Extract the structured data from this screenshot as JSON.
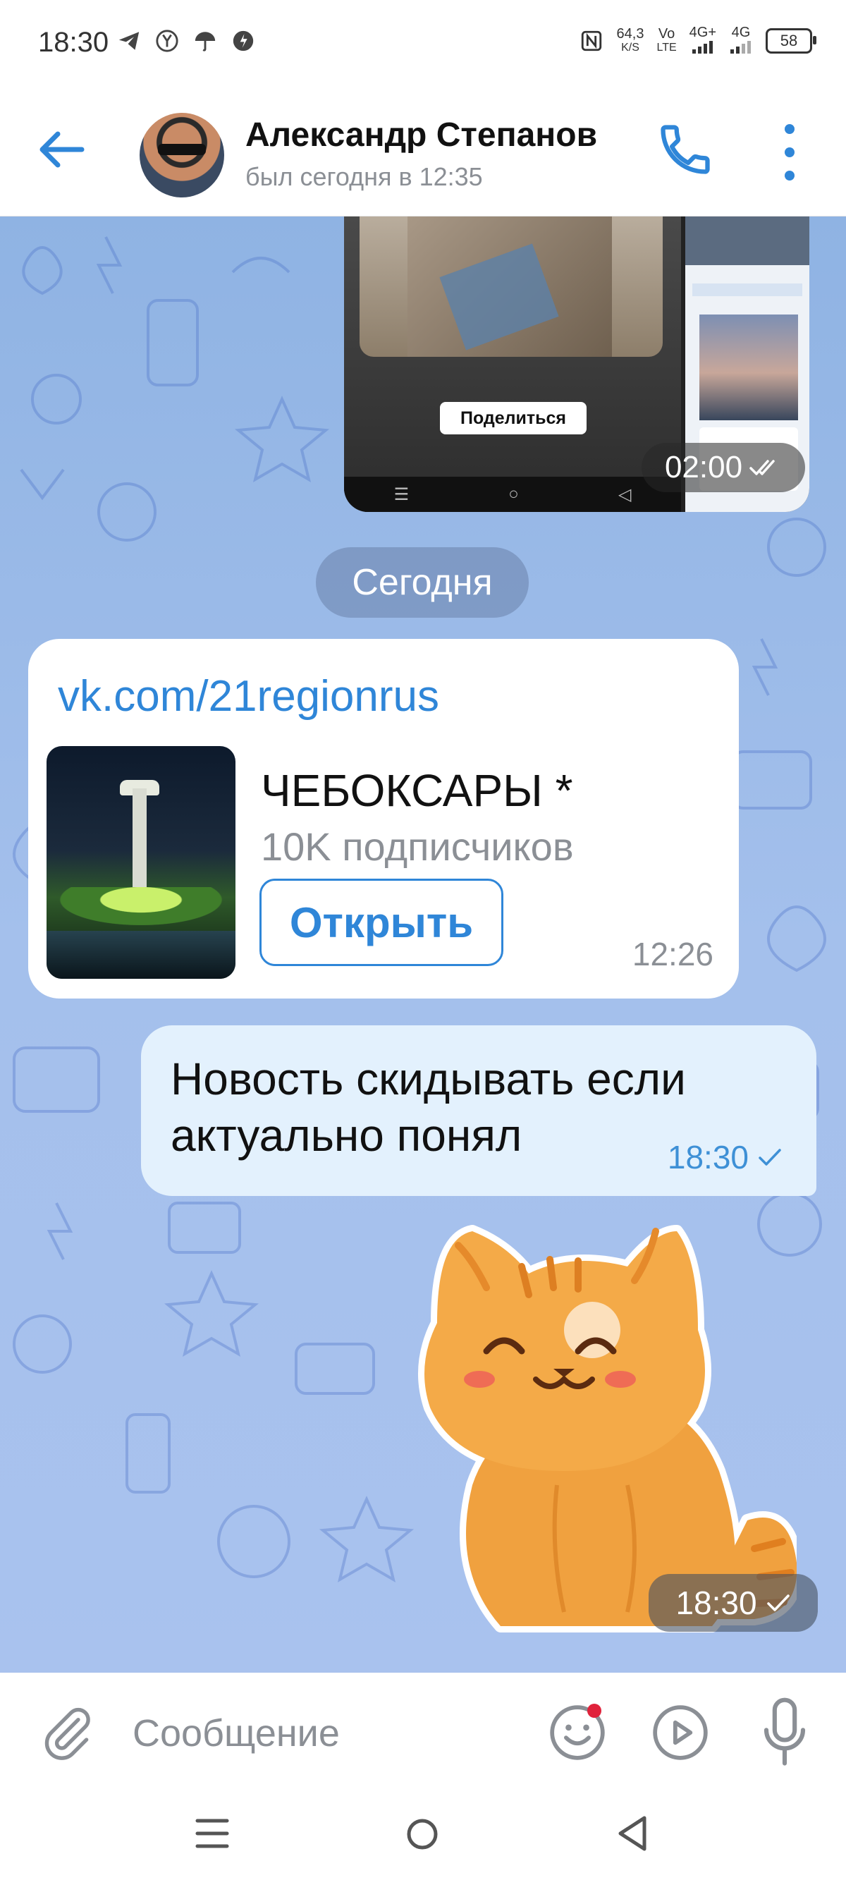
{
  "status_bar": {
    "time": "18:30",
    "net_speed_value": "64,3",
    "net_speed_unit": "K/S",
    "volte_top": "Vo",
    "volte_bottom": "LTE",
    "signal1": "4G+",
    "signal2": "4G",
    "battery": "58"
  },
  "header": {
    "contact_name": "Александр Степанов",
    "contact_status": "был сегодня в 12:35"
  },
  "messages": {
    "media": {
      "share_label": "Поделиться",
      "time": "02:00"
    },
    "date_separator": "Сегодня",
    "link_preview": {
      "url": "vk.com/21regionrus",
      "title": "ЧЕБОКСАРЫ *",
      "subtitle": "10K подписчиков",
      "open_label": "Открыть",
      "time": "12:26"
    },
    "outgoing_text": {
      "text": "Новость скидывать если\nактуально понял",
      "time": "18:30"
    },
    "sticker": {
      "time": "18:30"
    }
  },
  "composer": {
    "placeholder": "Сообщение"
  },
  "colors": {
    "accent": "#2f86d8",
    "chat_bg": "#a4c0ec",
    "out_bubble": "#e3f1fd",
    "unread_dot": "#e0223b"
  },
  "icons": [
    "telegram-icon",
    "yandex-icon",
    "umbrella-icon",
    "clock-icon",
    "nfc-icon",
    "back-arrow-icon",
    "phone-icon",
    "more-vert-icon",
    "double-check-icon",
    "check-icon",
    "paperclip-icon",
    "emoji-icon",
    "video-message-icon",
    "microphone-icon",
    "nav-menu-icon",
    "nav-home-icon",
    "nav-back-icon"
  ]
}
